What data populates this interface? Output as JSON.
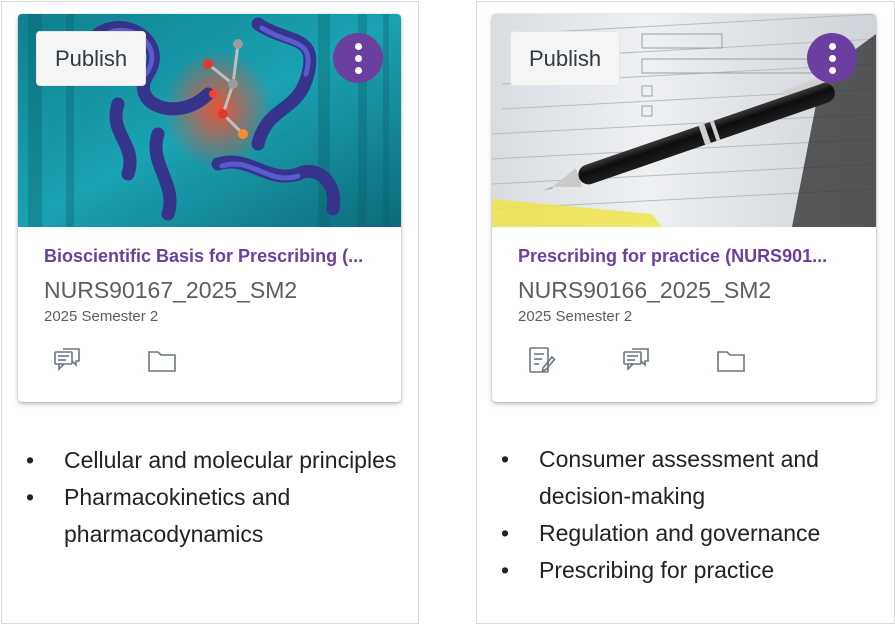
{
  "cards": [
    {
      "publish_label": "Publish",
      "course_name": "Bioscientific Basis for Prescribing (...",
      "course_code": "NURS90167_2025_SM2",
      "term": "2025 Semester 2",
      "icons": [
        "discussions-icon",
        "files-icon"
      ],
      "image_subject": "protein structure illustration",
      "bullets": [
        "Cellular and molecular principles",
        "Pharmacokinetics and pharmacodynamics"
      ]
    },
    {
      "publish_label": "Publish",
      "course_name": "Prescribing for practice (NURS901...",
      "course_code": "NURS90166_2025_SM2",
      "term": "2025 Semester 2",
      "icons": [
        "assignments-icon",
        "discussions-icon",
        "files-icon"
      ],
      "image_subject": "pen on paper form",
      "bullets": [
        "Consumer assessment and decision-making",
        "Regulation and governance",
        "Prescribing for practice"
      ]
    }
  ],
  "colors": {
    "accent": "#6b3fa0",
    "text_muted": "#5d5d5d"
  }
}
